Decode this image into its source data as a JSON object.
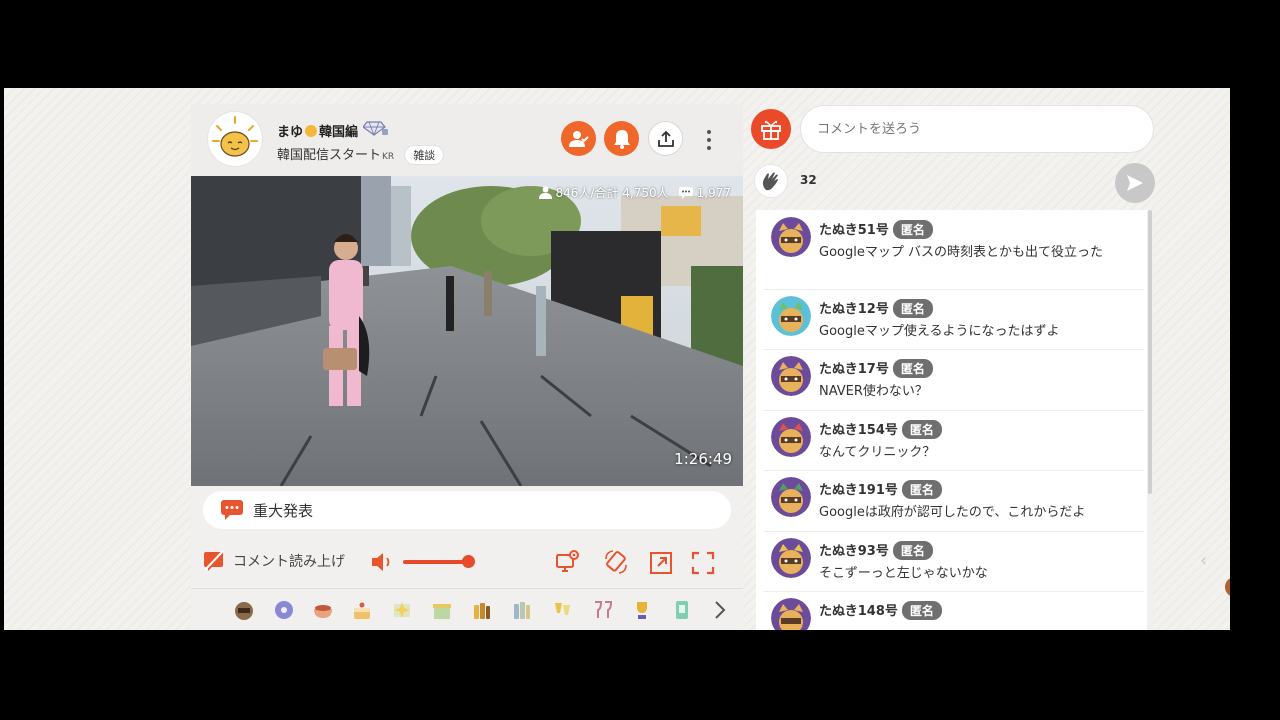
{
  "stream": {
    "title": "まゆ",
    "title_suffix": "韓国編",
    "subtitle": "韓国配信スタート",
    "subtitle_flag": "KR",
    "category_tag": "雑談",
    "viewers": "846人/合計 4,750人",
    "comment_count": "1,977",
    "elapsed_time": "1:26:49",
    "announcement": "重大発表"
  },
  "controls": {
    "tts_label": "コメント読み上げ",
    "volume_level": 0.8
  },
  "comment_box": {
    "placeholder": "コメントを送ろう",
    "clap_count": "32"
  },
  "badge_label": "匿名",
  "comments": [
    {
      "name": "たぬき51号",
      "text": "Googleマップ バスの時刻表とかも出て役立った",
      "avatar_bg": "#6b4b9a"
    },
    {
      "name": "たぬき12号",
      "text": "Googleマップ使えるようになったはずよ",
      "avatar_bg": "#5cc0d8"
    },
    {
      "name": "たぬき17号",
      "text": "NAVER使わない？",
      "avatar_bg": "#6b4b9a"
    },
    {
      "name": "たぬき154号",
      "text": "なんてクリニック？",
      "avatar_bg": "#6b4b9a"
    },
    {
      "name": "たぬき191号",
      "text": "Googleは政府が認可したので、これからだよ",
      "avatar_bg": "#6b4b9a"
    },
    {
      "name": "たぬき93号",
      "text": "そこずーっと左じゃないかな",
      "avatar_bg": "#6b4b9a"
    },
    {
      "name": "たぬき148号",
      "text": "",
      "avatar_bg": "#6b4b9a"
    }
  ],
  "colors": {
    "accent": "#f0672b",
    "gift": "#eb4a2a",
    "badge": "#6f6f6f"
  }
}
